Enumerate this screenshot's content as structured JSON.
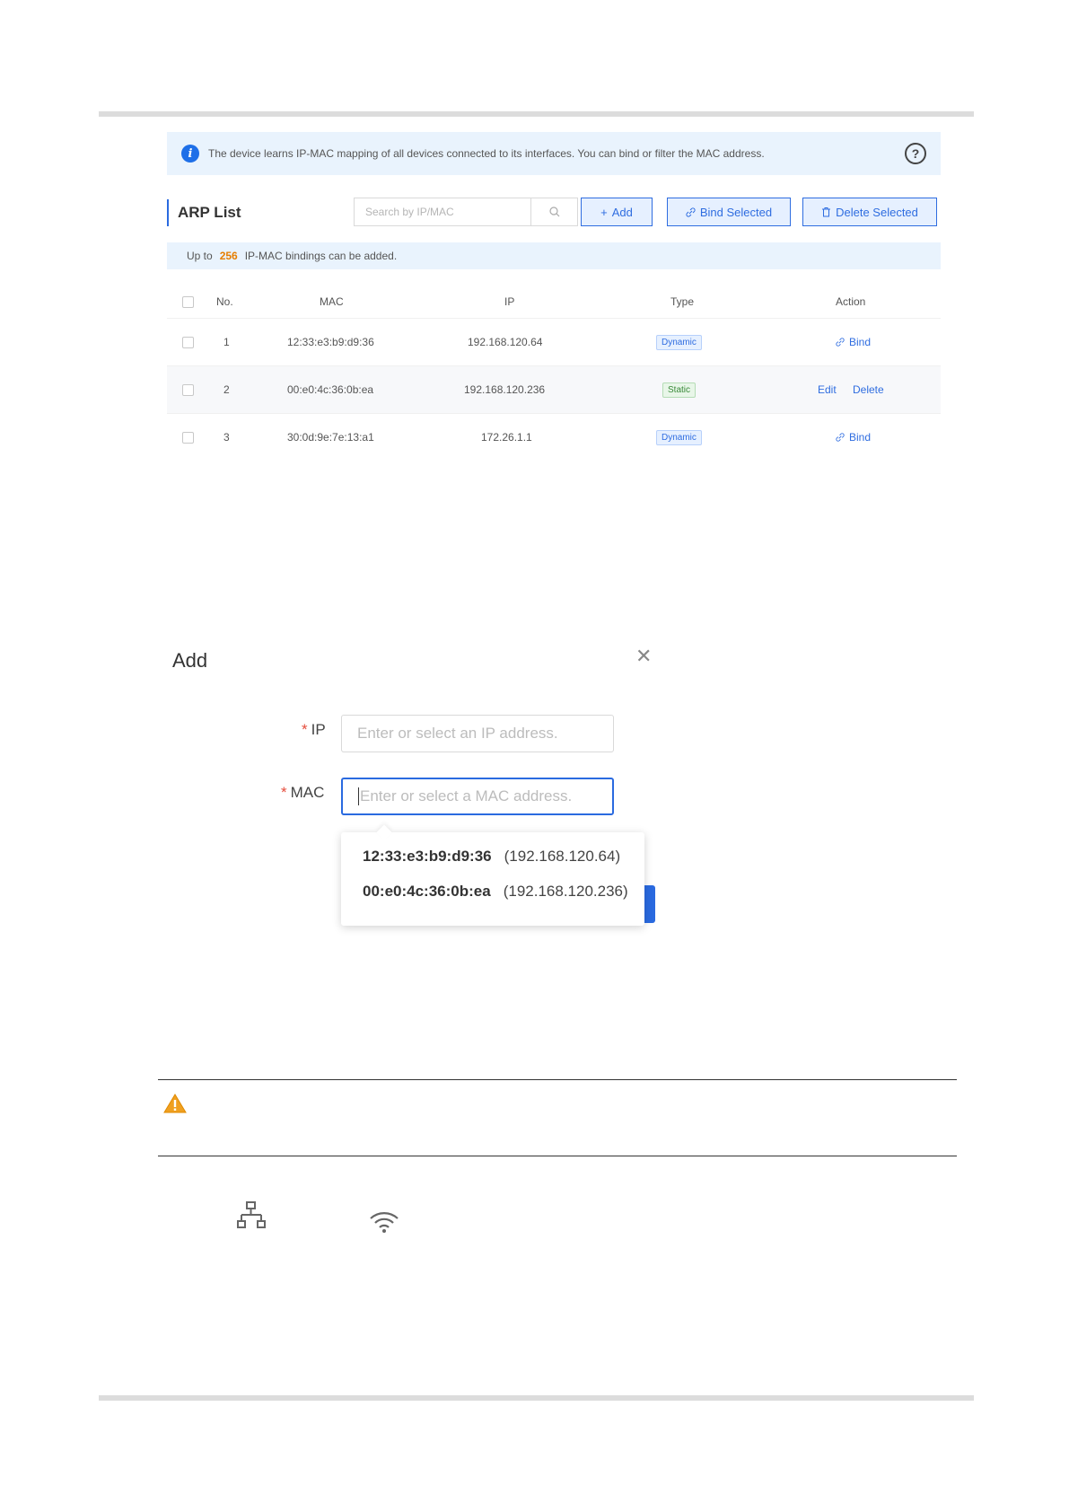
{
  "info_bar": {
    "text": "The device learns IP-MAC mapping of all devices connected to its interfaces. You can bind or filter the MAC address."
  },
  "arp_list": {
    "title": "ARP List",
    "search_placeholder": "Search by IP/MAC",
    "add_label": "Add",
    "bind_selected_label": "Bind Selected",
    "delete_selected_label": "Delete Selected",
    "notice": {
      "prefix": "Up to",
      "count": "256",
      "suffix": "IP-MAC bindings can be added."
    },
    "columns": [
      "No.",
      "MAC",
      "IP",
      "Type",
      "Action"
    ],
    "rows": [
      {
        "no": "1",
        "mac": "12:33:e3:b9:d9:36",
        "ip": "192.168.120.64",
        "type": "Dynamic",
        "action": "Bind"
      },
      {
        "no": "2",
        "mac": "00:e0:4c:36:0b:ea",
        "ip": "192.168.120.236",
        "type": "Static",
        "edit": "Edit",
        "delete": "Delete"
      },
      {
        "no": "3",
        "mac": "30:0d:9e:7e:13:a1",
        "ip": "172.26.1.1",
        "type": "Dynamic",
        "action": "Bind"
      }
    ]
  },
  "add_dialog": {
    "title": "Add",
    "ip_label": "IP",
    "ip_placeholder": "Enter or select an IP address.",
    "mac_label": "MAC",
    "mac_placeholder": "Enter or select a MAC address.",
    "required_mark": "*",
    "options": [
      {
        "mac": "12:33:e3:b9:d9:36",
        "ip": "(192.168.120.64)"
      },
      {
        "mac": "00:e0:4c:36:0b:ea",
        "ip": "(192.168.120.236)"
      }
    ]
  },
  "icons": [
    "info-icon",
    "help-icon",
    "search-icon",
    "link-icon",
    "trash-icon",
    "close-icon",
    "warning-icon",
    "wired-network-icon",
    "wifi-icon"
  ],
  "colors": {
    "accent": "#2a6ae0",
    "highlight": "#e67e00",
    "required": "#e54c3c",
    "warning": "#f0a020"
  }
}
